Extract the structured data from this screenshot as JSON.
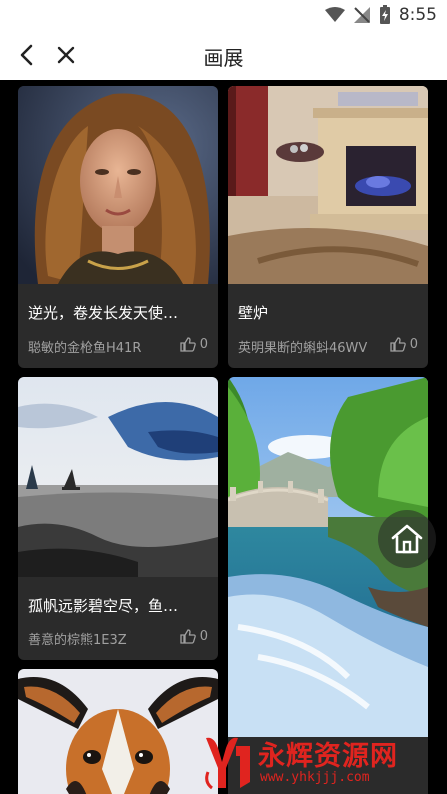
{
  "status_bar": {
    "time": "8:55"
  },
  "header": {
    "title": "画展"
  },
  "cards": [
    {
      "title": "逆光，卷发长发天使…",
      "author": "聪敏的金枪鱼H41R",
      "likes": "0"
    },
    {
      "title": "壁炉",
      "author": "英明果断的蝌蚪46WV",
      "likes": "0"
    },
    {
      "title": "孤帆远影碧空尽，鱼…",
      "author": "善意的棕熊1E3Z",
      "likes": "0"
    }
  ],
  "watermark": {
    "brand": "永辉资源网",
    "url": "www.yhkjjj.com"
  }
}
